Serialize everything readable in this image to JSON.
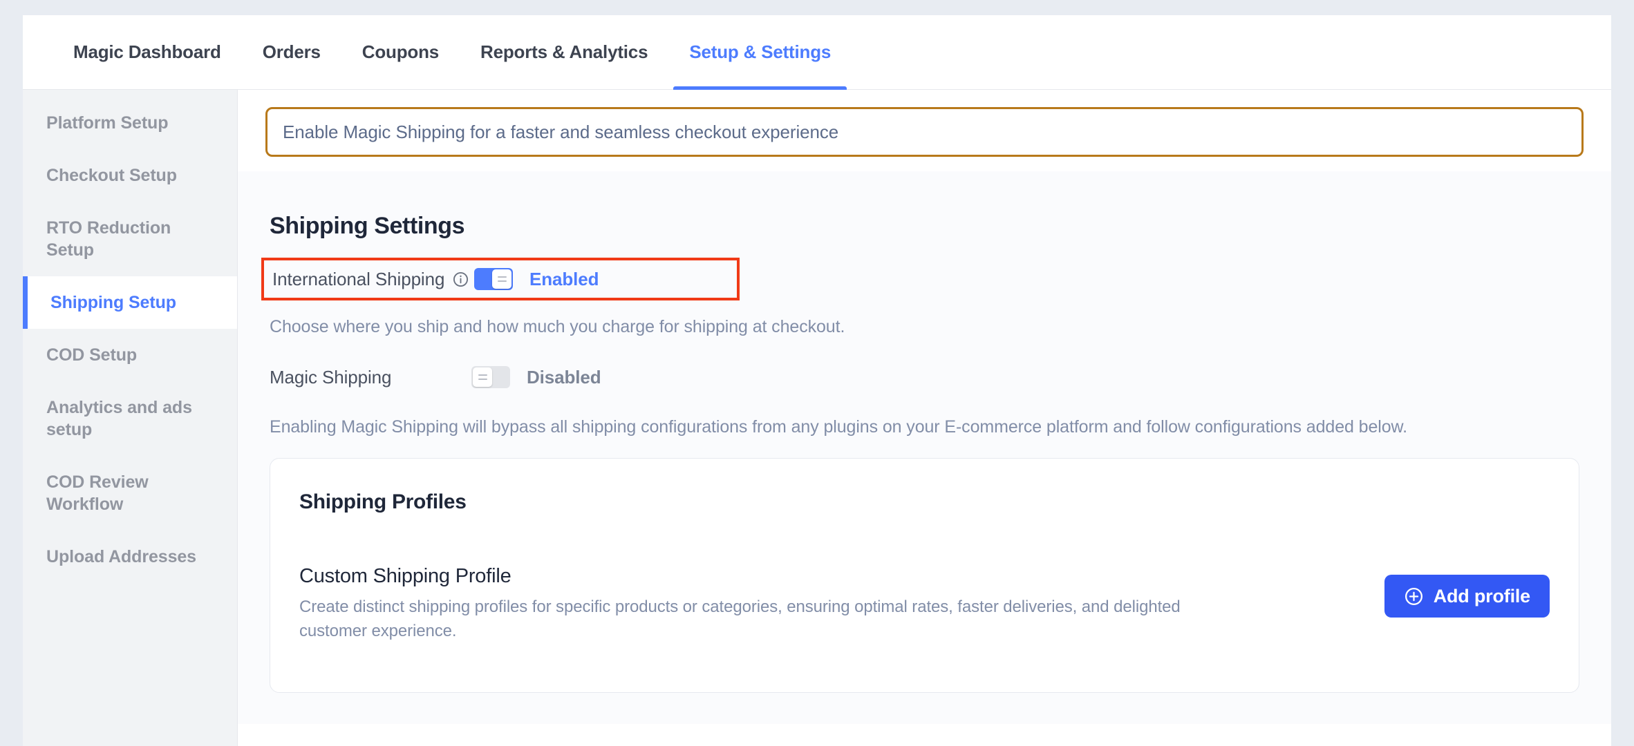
{
  "tabs": [
    {
      "label": "Magic Dashboard",
      "active": false
    },
    {
      "label": "Orders",
      "active": false
    },
    {
      "label": "Coupons",
      "active": false
    },
    {
      "label": "Reports & Analytics",
      "active": false
    },
    {
      "label": "Setup & Settings",
      "active": true
    }
  ],
  "sidebar": {
    "items": [
      {
        "label": "Platform Setup",
        "active": false
      },
      {
        "label": "Checkout Setup",
        "active": false
      },
      {
        "label": "RTO Reduction Setup",
        "active": false
      },
      {
        "label": "Shipping Setup",
        "active": true
      },
      {
        "label": "COD Setup",
        "active": false
      },
      {
        "label": "Analytics and ads setup",
        "active": false
      },
      {
        "label": "COD Review Workflow",
        "active": false
      },
      {
        "label": "Upload Addresses",
        "active": false
      }
    ]
  },
  "banner": {
    "text": "Enable Magic Shipping for a faster and seamless checkout experience",
    "border_color": "#b8791a"
  },
  "main": {
    "section_title": "Shipping Settings",
    "international_shipping": {
      "label": "International Shipping",
      "info_icon": "info-circle-icon",
      "status": "Enabled",
      "toggle_on": true,
      "helper": "Choose where you ship and how much you charge for shipping at checkout.",
      "highlight_color": "#f03a17"
    },
    "magic_shipping": {
      "label": "Magic Shipping",
      "status": "Disabled",
      "toggle_on": false,
      "helper": "Enabling Magic Shipping will bypass all shipping configurations from any plugins on your E-commerce platform and follow configurations added below."
    },
    "profiles_card": {
      "title": "Shipping Profiles",
      "profile_name": "Custom Shipping Profile",
      "profile_desc": "Create distinct shipping profiles for specific products or categories, ensuring optimal rates, faster deliveries, and delighted customer experience.",
      "add_button_label": "Add profile",
      "add_button_icon": "plus-circle-icon",
      "add_button_color": "#3358f4"
    }
  },
  "theme": {
    "accent": "#4d7cfe",
    "page_bg": "#e8ecf2"
  }
}
